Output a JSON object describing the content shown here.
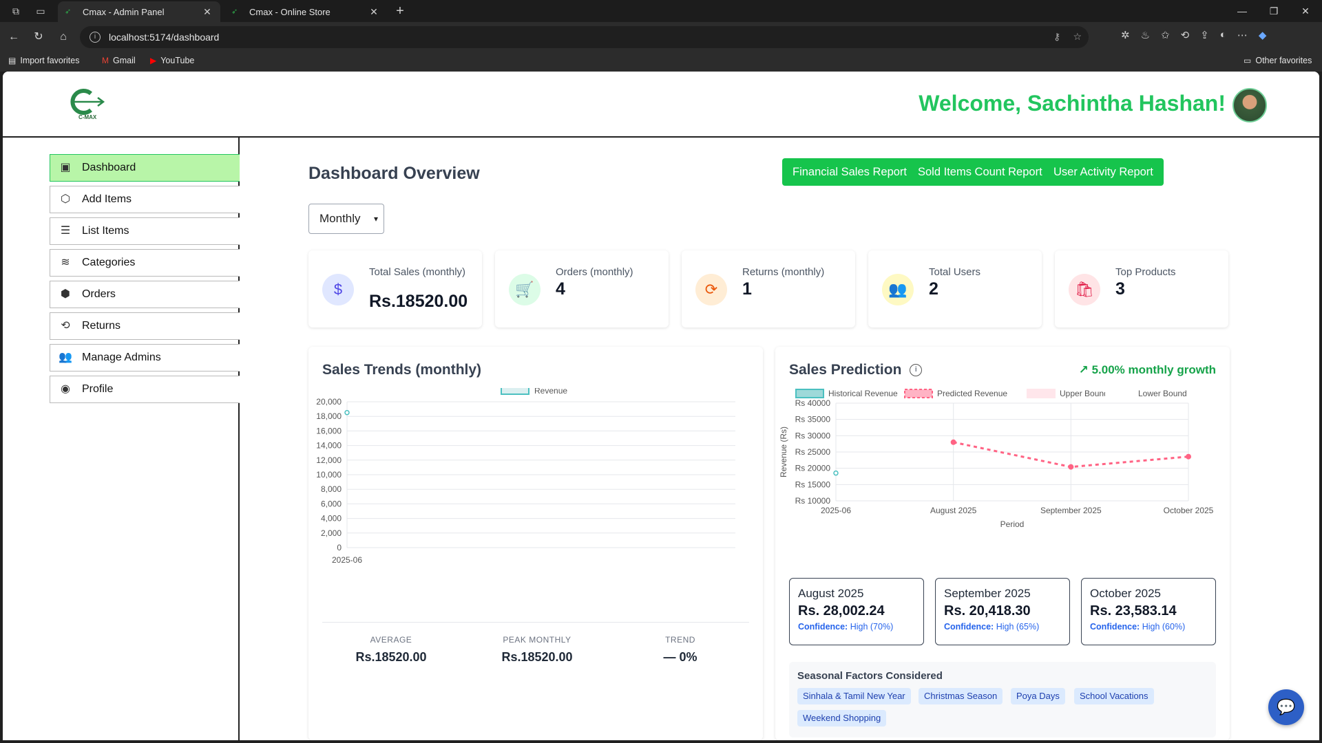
{
  "browser": {
    "tabs": [
      {
        "title": "Cmax - Admin Panel",
        "active": true
      },
      {
        "title": "Cmax - Online Store",
        "active": false
      }
    ],
    "url": "localhost:5174/dashboard",
    "bookmarks": [
      "Import favorites",
      "Gmail",
      "YouTube"
    ],
    "other_favorites": "Other favorites"
  },
  "header": {
    "logo_text": "C-MAX",
    "welcome": "Welcome, Sachintha Hashan!"
  },
  "sidebar": {
    "items": [
      {
        "label": "Dashboard",
        "icon": "monitor-icon",
        "active": true
      },
      {
        "label": "Add Items",
        "icon": "box-add-icon"
      },
      {
        "label": "List Items",
        "icon": "list-icon"
      },
      {
        "label": "Categories",
        "icon": "layers-icon"
      },
      {
        "label": "Orders",
        "icon": "orders-icon"
      },
      {
        "label": "Returns",
        "icon": "returns-icon"
      },
      {
        "label": "Manage Admins",
        "icon": "users-icon"
      },
      {
        "label": "Profile",
        "icon": "profile-icon"
      }
    ]
  },
  "main": {
    "title": "Dashboard Overview",
    "buttons": [
      "Financial Sales Report",
      "Sold Items Count Report",
      "User Activity Report"
    ],
    "period": "Monthly",
    "stats": [
      {
        "label": "Total Sales (monthly)",
        "value": "Rs.18520.00",
        "icon": "dollar-icon",
        "color": "#4f46e5",
        "bg": "#e0e7ff"
      },
      {
        "label": "Orders (monthly)",
        "value": "4",
        "icon": "cart-icon",
        "color": "#16a34a",
        "bg": "#dcfce7"
      },
      {
        "label": "Returns (monthly)",
        "value": "1",
        "icon": "refresh-icon",
        "color": "#ea580c",
        "bg": "#ffedd5"
      },
      {
        "label": "Total Users",
        "value": "2",
        "icon": "users-icon",
        "color": "#ca8a04",
        "bg": "#fef9c3"
      },
      {
        "label": "Top Products",
        "value": "3",
        "icon": "bag-icon",
        "color": "#e11d48",
        "bg": "#ffe4e6"
      }
    ]
  },
  "trends": {
    "title": "Sales Trends (monthly)",
    "summary": [
      {
        "label": "AVERAGE",
        "value": "Rs.18520.00"
      },
      {
        "label": "PEAK MONTHLY",
        "value": "Rs.18520.00"
      },
      {
        "label": "TREND",
        "value": "— 0%"
      }
    ]
  },
  "prediction": {
    "title": "Sales Prediction",
    "growth": "5.00% monthly growth",
    "cards": [
      {
        "month": "August 2025",
        "value": "Rs. 28,002.24",
        "confidence": "High (70%)"
      },
      {
        "month": "September 2025",
        "value": "Rs. 20,418.30",
        "confidence": "High (65%)"
      },
      {
        "month": "October 2025",
        "value": "Rs. 23,583.14",
        "confidence": "High (60%)"
      }
    ],
    "confidence_label": "Confidence:",
    "seasonal_title": "Seasonal Factors Considered",
    "seasonal_factors": [
      "Sinhala & Tamil New Year",
      "Christmas Season",
      "Poya Days",
      "School Vacations",
      "Weekend Shopping"
    ]
  },
  "chart_data": [
    {
      "type": "line",
      "title": "Sales Trends (monthly)",
      "x": [
        "2025-06"
      ],
      "series": [
        {
          "name": "Revenue",
          "values": [
            18520
          ],
          "color": "#4bc0c0"
        }
      ],
      "ylim": [
        0,
        20000
      ],
      "yticks": [
        0,
        2000,
        4000,
        6000,
        8000,
        10000,
        12000,
        14000,
        16000,
        18000,
        20000
      ],
      "ytick_labels": [
        "0",
        "2,000",
        "4,000",
        "6,000",
        "8,000",
        "10,000",
        "12,000",
        "14,000",
        "16,000",
        "18,000",
        "20,000"
      ],
      "grid": true,
      "legend": "top"
    },
    {
      "type": "line",
      "x": [
        "2025-06",
        "August 2025",
        "September 2025",
        "October 2025"
      ],
      "series": [
        {
          "name": "Historical Revenue",
          "values": [
            18520,
            null,
            null,
            null
          ],
          "color": "#4bc0c0"
        },
        {
          "name": "Predicted Revenue",
          "values": [
            null,
            28002.24,
            20418.3,
            23583.14
          ],
          "color": "#ff6384"
        },
        {
          "name": "Upper Bound",
          "values": [],
          "color": "#ffe0e6"
        },
        {
          "name": "Lower Bound",
          "values": [],
          "color": "#ffffff"
        }
      ],
      "xlabel": "Period",
      "ylabel": "Revenue (Rs)",
      "ylim": [
        10000,
        40000
      ],
      "yticks": [
        10000,
        15000,
        20000,
        25000,
        30000,
        35000,
        40000
      ],
      "ytick_prefix": "Rs ",
      "grid": true,
      "legend": "top"
    }
  ]
}
